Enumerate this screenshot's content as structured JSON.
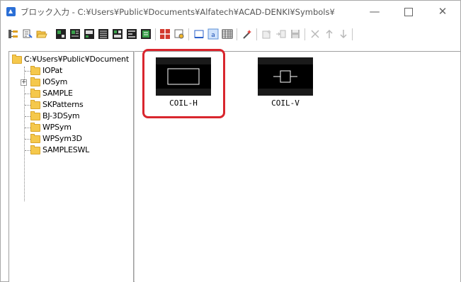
{
  "window": {
    "title": "ブロック入力 - C:¥Users¥Public¥Documents¥Alfatech¥ACAD-DENKI¥Symbols¥",
    "controls": {
      "minimize": "—",
      "close": "✕"
    }
  },
  "toolbar": {
    "buttons": [
      "tree-root-icon",
      "properties-icon",
      "folder-open-icon",
      "symbol-view-1-icon",
      "symbol-view-2-icon",
      "symbol-view-3-icon",
      "symbol-view-4-icon",
      "symbol-view-5-icon",
      "symbol-view-6-icon",
      "symbol-view-7-icon",
      "red-grid-icon",
      "settings-icon",
      "page-icon",
      "page-label-icon",
      "table-icon",
      "wand-icon",
      "new-disabled-icon",
      "copy-disabled-icon",
      "save-disabled-icon",
      "delete-disabled-icon",
      "up-disabled-icon",
      "down-disabled-icon"
    ]
  },
  "tree": {
    "root": "C:¥Users¥Public¥Document",
    "items": [
      "IOPat",
      "IOSym",
      "SAMPLE",
      "SKPatterns",
      "BJ-3DSym",
      "WPSym",
      "WPSym3D",
      "SAMPLESWL"
    ]
  },
  "symbols": [
    {
      "label": "COIL-H",
      "icon": "coil-horizontal-icon",
      "selected": true
    },
    {
      "label": "COIL-V",
      "icon": "coil-vertical-icon",
      "selected": false
    }
  ],
  "colors": {
    "highlight": "#d9262e",
    "folder": "#f5c84c",
    "thumb_bg": "#000000"
  }
}
